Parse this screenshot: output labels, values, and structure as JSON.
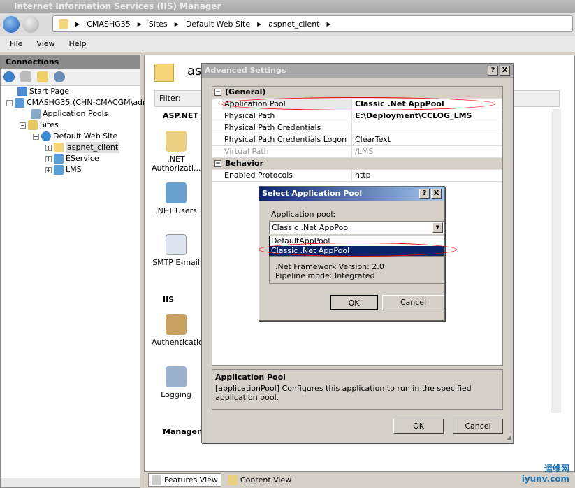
{
  "window": {
    "title": "Internet Information Services (IIS) Manager"
  },
  "address": {
    "segments": [
      "CMASHG35",
      "Sites",
      "Default Web Site",
      "aspnet_client"
    ]
  },
  "menu": [
    "File",
    "View",
    "Help"
  ],
  "connections": {
    "title": "Connections",
    "tree": [
      {
        "label": "Start Page"
      },
      {
        "label": "CMASHG35 (CHN-CMACGM\\admi"
      },
      {
        "label": "Application Pools"
      },
      {
        "label": "Sites"
      },
      {
        "label": "Default Web Site"
      },
      {
        "label": "aspnet_client"
      },
      {
        "label": "EService"
      },
      {
        "label": "LMS"
      }
    ]
  },
  "main": {
    "heading": "as",
    "filter_label": "Filter:",
    "groups": {
      "aspnet": "ASP.NET",
      "iis": "IIS",
      "management": "Managem"
    },
    "features": [
      ".NET Authorizati...",
      ".NET Users",
      "SMTP E-mail",
      "Authenticatio",
      "Logging"
    ]
  },
  "tabs": {
    "features": "Features View",
    "content": "Content View"
  },
  "advanced": {
    "title": "Advanced Settings",
    "help": "?",
    "close": "X",
    "categories": {
      "general": "(General)",
      "behavior": "Behavior"
    },
    "rows": [
      {
        "key": "Application Pool",
        "value": "Classic .Net AppPool"
      },
      {
        "key": "Physical Path",
        "value": "E:\\Deployment\\CCLOG_LMS"
      },
      {
        "key": "Physical Path Credentials",
        "value": ""
      },
      {
        "key": "Physical Path Credentials Logon Type",
        "value": "ClearText"
      },
      {
        "key": "Virtual Path",
        "value": "/LMS"
      },
      {
        "key": "Enabled Protocols",
        "value": "http"
      }
    ],
    "desc_title": "Application Pool",
    "desc_text": "[applicationPool] Configures this application to run in the specified application pool.",
    "ok": "OK",
    "cancel": "Cancel"
  },
  "select": {
    "title": "Select Application Pool",
    "help": "?",
    "close": "X",
    "label": "Application pool:",
    "value": "Classic .Net AppPool",
    "options": [
      "DefaultAppPool",
      "Classic .Net AppPool"
    ],
    "framework": ".Net Framework Version: 2.0",
    "pipeline": "Pipeline mode: Integrated",
    "ok": "OK",
    "cancel": "Cancel"
  },
  "watermark": {
    "cn": "运维网",
    "en": "iyunv.com"
  }
}
